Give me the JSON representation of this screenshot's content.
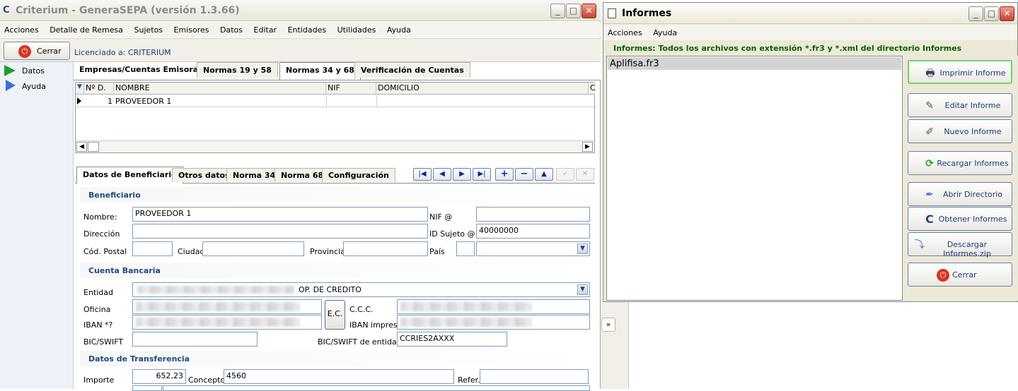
{
  "main_window": {
    "title": "Criterium - GeneraSEPA (versión 1.3.66)",
    "menu": [
      "Acciones",
      "Detalle de Remesa",
      "Sujetos",
      "Emisores",
      "Datos",
      "Editar",
      "Entidades",
      "Utilidades",
      "Ayuda"
    ],
    "close_button": "Cerrar",
    "license": "Licenciado a: CRITERIUM",
    "sidebar": [
      {
        "label": "Datos",
        "icon": "green-arrow-icon"
      },
      {
        "label": "Ayuda",
        "icon": "blue-arrow-icon"
      }
    ],
    "top_tabs": [
      "Empresas/Cuentas Emisoras",
      "Normas 19 y 58",
      "Normas 34 y 68",
      "Verificación de Cuentas"
    ],
    "grid": {
      "columns": [
        "Nº D.",
        "NOMBRE",
        "NIF",
        "DOMICILIO",
        "C"
      ],
      "rows": [
        [
          "1",
          "PROVEEDOR 1",
          "",
          ""
        ]
      ]
    },
    "detail_tabs": [
      "Datos de Beneficiario",
      "Otros datos",
      "Norma 34",
      "Norma 68",
      "Configuración"
    ],
    "sections": {
      "beneficiario": "Beneficiario",
      "cuenta": "Cuenta Bancaria",
      "transferencia": "Datos de Transferencia"
    },
    "labels": {
      "nombre": "Nombre:",
      "direccion": "Dirección",
      "cod_postal": "Cód. Postal",
      "ciudad": "Ciudad",
      "provincia": "Provincia",
      "pais": "País",
      "nif": "NIF @",
      "id_sujeto": "ID Sujeto @",
      "entidad": "Entidad",
      "oficina": "Oficina",
      "iban": "IBAN *?",
      "bic": "BIC/SWIFT",
      "ccc": "C.C.C.",
      "iban_impreso": "IBAN impreso",
      "bic_entidad": "BIC/SWIFT de entidad",
      "ec": "E.C.",
      "importe": "Importe",
      "concepto": "Concepto",
      "refer": "Refer."
    },
    "values": {
      "nombre": "PROVEEDOR 1",
      "id_sujeto": "40000000",
      "entidad_suffix": "OP. DE CREDITO",
      "bic_entidad": "CCRIES2AXXX",
      "importe": "652,23",
      "concepto": "4560"
    }
  },
  "informes_window": {
    "title": "Informes",
    "menu": [
      "Acciones",
      "Ayuda"
    ],
    "info": "Informes: Todos los archivos con extensión *.fr3 y *.xml del directorio Informes",
    "files": [
      "Aplifisa.fr3"
    ],
    "buttons": [
      {
        "label": "Imprimir Informe",
        "icon": "printer-icon"
      },
      {
        "label": "Editar Informe",
        "icon": "edit-icon"
      },
      {
        "label": "Nuevo Informe",
        "icon": "new-icon"
      },
      {
        "label": "Recargar Informes",
        "icon": "reload-icon"
      },
      {
        "label": "Abrir Directorio",
        "icon": "folder-icon"
      },
      {
        "label": "Obtener Informes",
        "icon": "criterium-logo-icon"
      },
      {
        "label": "Descargar Informes.zip",
        "icon": "download-icon"
      },
      {
        "label": "Cerrar",
        "icon": "power-icon"
      }
    ]
  },
  "colors": {
    "section_text": "#1e4b7f",
    "info_text": "#006400",
    "link_text": "#1b3a7a",
    "close_red": "#d8341f"
  }
}
